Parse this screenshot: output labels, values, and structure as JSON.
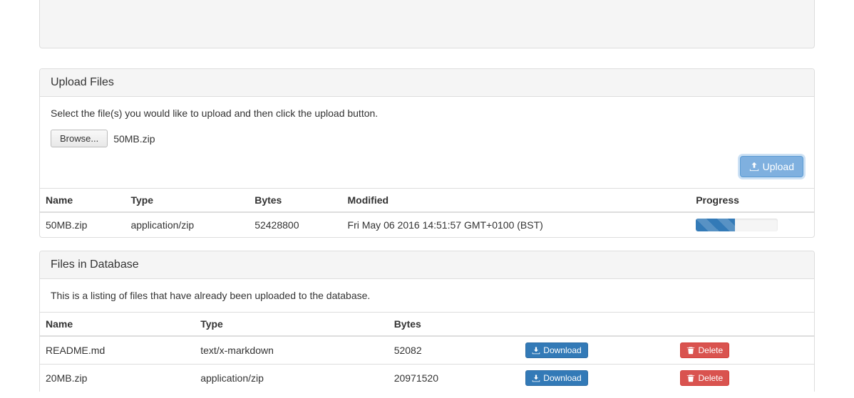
{
  "upload_panel": {
    "heading": "Upload Files",
    "description": "Select the file(s) you would like to upload and then click the upload button.",
    "browse_label": "Browse...",
    "selected_file": "50MB.zip",
    "upload_label": "Upload",
    "columns": {
      "name": "Name",
      "type": "Type",
      "bytes": "Bytes",
      "modified": "Modified",
      "progress": "Progress"
    },
    "rows": [
      {
        "name": "50MB.zip",
        "type": "application/zip",
        "bytes": "52428800",
        "modified": "Fri May 06 2016 14:51:57 GMT+0100 (BST)",
        "progress_percent": 48
      }
    ]
  },
  "db_panel": {
    "heading": "Files in Database",
    "description": "This is a listing of files that have already been uploaded to the database.",
    "columns": {
      "name": "Name",
      "type": "Type",
      "bytes": "Bytes"
    },
    "download_label": "Download",
    "delete_label": "Delete",
    "rows": [
      {
        "name": "README.md",
        "type": "text/x-markdown",
        "bytes": "52082"
      },
      {
        "name": "20MB.zip",
        "type": "application/zip",
        "bytes": "20971520"
      }
    ]
  }
}
